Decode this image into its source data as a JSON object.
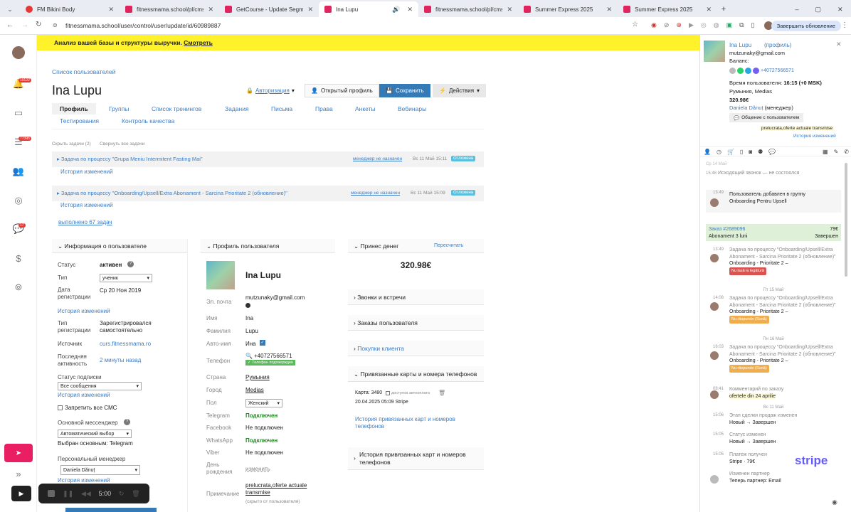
{
  "browser": {
    "tabs": [
      {
        "title": "FM Bikini Body",
        "fav": "#e53935"
      },
      {
        "title": "fitnessmama.school/pl/cms/pa...",
        "fav": "#e0245e"
      },
      {
        "title": "GetCourse - Update Segment",
        "fav": "#e0245e"
      },
      {
        "title": "Ina Lupu",
        "fav": "#e0245e"
      },
      {
        "title": "fitnessmama.school/pl/cms/pa...",
        "fav": "#e0245e"
      },
      {
        "title": "Summer Express 2025",
        "fav": "#e0245e"
      },
      {
        "title": "Summer Express 2025",
        "fav": "#e0245e"
      }
    ],
    "url": "fitnessmama.school/user/control/user/update/id/60989887",
    "update_label": "Завершить обновление"
  },
  "rail": {
    "badges": [
      "10122",
      "77395",
      "17"
    ]
  },
  "banner": {
    "text": "Анализ вашей базы и структуры выручки.",
    "link": "Смотреть"
  },
  "header": {
    "breadcrumb": "Список пользователей",
    "title": "Ina Lupu",
    "auth_label": "Авторизация",
    "open_profile": "Открытый профиль",
    "save": "Сохранить",
    "actions": "Действия",
    "tabs": [
      "Профиль",
      "Группы",
      "Список тренингов",
      "Задания",
      "Письма",
      "Права",
      "Анкеты",
      "Вебинары"
    ],
    "tabs2": [
      "Тестирования",
      "Контроль качества"
    ]
  },
  "tasks": {
    "hide": "Скрыть задачи (2)",
    "collapse": "Свернуть все задачи",
    "items": [
      {
        "title": "Задача по процессу \"Grupa Meniu Intermitent Fasting Mai\"",
        "manager": "менеджер не назначен",
        "date": "Вс 11 Май 15:11",
        "status": "Отложена",
        "history": "История изменений"
      },
      {
        "title": "Задача по процессу \"Onboarding/Upsell/Extra Abonament - Sarcina Prioritate 2 (обновление)\"",
        "manager": "менеджер не назначен",
        "date": "Вс 11 Май 15:09",
        "status": "Отложена",
        "history": "История изменений"
      }
    ],
    "done": "выполнено 67 задач"
  },
  "info": {
    "title": "Информация о пользователе",
    "status_l": "Статус",
    "status_v": "активен",
    "type_l": "Тип",
    "type_v": "ученик",
    "regdate_l": "Дата регистрации",
    "regdate_v": "Ср 20 Ноя 2019",
    "history": "История изменений",
    "regtype_l": "Тип регистрации",
    "regtype_v": "Зарегистрировался самостоятельно",
    "source_l": "Источник",
    "source_v": "curs.fitnessmama.ro",
    "last_l": "Последняя активность",
    "last_v": "2 минуты назад",
    "sub_l": "Статус подписки",
    "sub_v": "Все сообщения",
    "history2": "История изменений",
    "sms": "Запретить все СМС",
    "msgr_l": "Основной мессенджер",
    "msgr_v": "Автоматический выбор",
    "msgr_chosen": "Выбран основным: Telegram",
    "pm_l": "Персональный менеджер",
    "pm_v": "Daniela Dănuț",
    "history3": "История изменений"
  },
  "profile": {
    "title": "Профиль пользователя",
    "name": "Ina Lupu",
    "email_l": "Эл. почта",
    "email_v": "mutzunaky@gmail.com",
    "fname_l": "Имя",
    "fname_v": "Ina",
    "lname_l": "Фамилия",
    "lname_v": "Lupu",
    "autoname_l": "Авто-имя",
    "autoname_v": "Ина",
    "phone_l": "Телефон",
    "phone_v": "+40727566571",
    "phone_ok": "Телефон подтвержден",
    "country_l": "Страна",
    "country_v": "Румыния",
    "city_l": "Город",
    "city_v": "Medias",
    "gender_l": "Пол",
    "gender_v": "Женский",
    "tg_l": "Telegram",
    "tg_v": "Подключен",
    "fb_l": "Facebook",
    "fb_v": "Не подключен",
    "wa_l": "WhatsApp",
    "wa_v": "Подключен",
    "vb_l": "Viber",
    "vb_v": "Не подключен",
    "bd_l": "День рождения",
    "bd_v": "изменить",
    "note_l": "Примечание",
    "note_v": "prelucrata,oferte actuale transmise",
    "note_sub": "(скрыто от пользователя)"
  },
  "money": {
    "title": "Принес денег",
    "recalc": "Пересчитать",
    "amount": "320.98€",
    "calls": "Звонки и встречи",
    "orders": "Заказы пользователя",
    "purchases": "Покупки клиента",
    "cards": "Привязанные карты и номера телефонов",
    "card": "Карта: 3480",
    "autopay": "доступна автооплата",
    "card_date": "20.04.2025 05:09 Stripe",
    "card_hist": "История привязанных карт и номеров телефонов",
    "hist2": "История привязанных карт и номеров телефонов"
  },
  "right": {
    "name": "Ina Lupu",
    "profile": "(профиль)",
    "email": "mutzunaky@gmail.com",
    "balance": "Баланс:",
    "phone": "+40727566571",
    "time_l": "Время пользователя:",
    "time_v": "16:15 (+0 MSK)",
    "loc": "Румыния, Medias",
    "amount": "320.98€",
    "manager": "Daniela Dănuț",
    "manager_role": "(менеджер)",
    "chat": "Общение с пользователем",
    "note": "prelucrata,oferte actuale transmise",
    "history": "История изменений",
    "feed": [
      {
        "time": "Ср 14 Май",
        "text": ""
      },
      {
        "time": "15:48",
        "text": "Исходящий звонок — не состоялся"
      },
      {
        "time": "13:49",
        "text": "Пользователь добавлен в группу",
        "sub": "Onboarding Pentru Upsell"
      },
      {
        "order": "Заказ #2689096",
        "price": "79€",
        "name": "Abonament 3 luni",
        "status": "Завершен"
      },
      {
        "time": "13:49",
        "text": "Задача по процессу \"Onboarding/Upsell/Extra Abonament - Sarcina Prioritate 2 (обновление)\"",
        "sub": "Onboarding - Prioritate 2 –",
        "tag": "Nu lasă la legătură"
      },
      {
        "day": "Пт 15 Май"
      },
      {
        "time": "14:08",
        "text": "Задача по процессу \"Onboarding/Upsell/Extra Abonament - Sarcina Prioritate 2 (обновление)\"",
        "sub": "Onboarding - Prioritate 2 –",
        "tag": "Nu răspunde (Sună)"
      },
      {
        "day": "Пн 16 Май"
      },
      {
        "time": "16:03",
        "text": "Задача по процессу \"Onboarding/Upsell/Extra Abonament - Sarcina Prioritate 2 (обновление)\"",
        "sub": "Onboarding - Prioritate 2 –",
        "tag": "Nu răspunde (Sună)"
      },
      {
        "time": "08:41",
        "text": "Комментарий по заказу",
        "sub": "ofertele din 24 aprilie"
      },
      {
        "day": "Вс 11 Май"
      },
      {
        "time": "15:06",
        "text": "Этап сделки продаж изменен",
        "sub": "Новый → Завершен"
      },
      {
        "time": "15:05",
        "text": "Статус изменен",
        "sub": "Новый → Завершен"
      },
      {
        "time": "15:05",
        "text": "Платеж получен",
        "sub": "Stripe · 79€"
      },
      {
        "time": "",
        "text": "Изменен партнер",
        "sub": "Теперь партнер: Email"
      }
    ],
    "stripe": "stripe"
  },
  "recorder": {
    "time": "5:00"
  }
}
